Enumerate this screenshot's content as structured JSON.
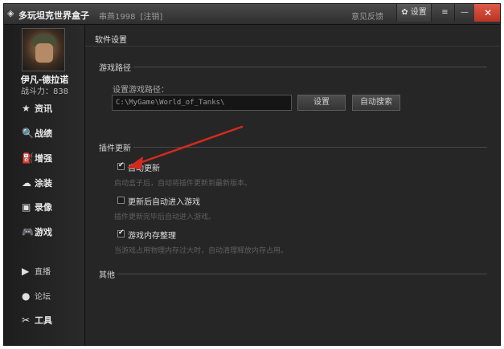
{
  "titlebar": {
    "app_title": "多玩坦克世界盒子",
    "account_name": "串燕1998",
    "logout": "[注销]",
    "feedback": "意见反馈",
    "settings_button": "✿ 设置",
    "menu_icon": "≡",
    "minimize_icon": "—",
    "close_icon": "✕"
  },
  "sidebar": {
    "player_name": "伊凡-德拉诺",
    "combat_power": "战斗力：838",
    "items": [
      {
        "icon": "★",
        "label": "资讯"
      },
      {
        "icon": "🔍",
        "label": "战绩"
      },
      {
        "icon": "⛽",
        "label": "增强"
      },
      {
        "icon": "☁",
        "label": "涂装"
      },
      {
        "icon": "▣",
        "label": "录像"
      },
      {
        "icon": "🎮",
        "label": "游戏"
      }
    ],
    "bottom_items": [
      {
        "icon": "▶",
        "label": "直播"
      },
      {
        "icon": "●",
        "label": "论坛"
      },
      {
        "icon": "✂",
        "label": "工具"
      }
    ]
  },
  "main": {
    "page_title": "软件设置",
    "game_path_section": "游戏路径",
    "path_label": "设置游戏路径：",
    "path_value": "C:\\MyGame\\World_of_Tanks\\",
    "set_button": "设置",
    "auto_search_button": "自动搜索",
    "plugin_section": "插件更新",
    "options": [
      {
        "label": "自动更新",
        "checked": true,
        "desc": "启动盒子后，自动将插件更新到最新版本。"
      },
      {
        "label": "更新后自动进入游戏",
        "checked": false,
        "desc": "插件更新完毕后自动进入游戏。"
      },
      {
        "label": "游戏内存整理",
        "checked": true,
        "desc": "当游戏占用物理内存过大时，自动清理释放内存占用。"
      }
    ],
    "other_section": "其他"
  },
  "colors": {
    "background": "#262626",
    "close_button": "#c9402e",
    "annotation_arrow": "#d42a1e"
  }
}
